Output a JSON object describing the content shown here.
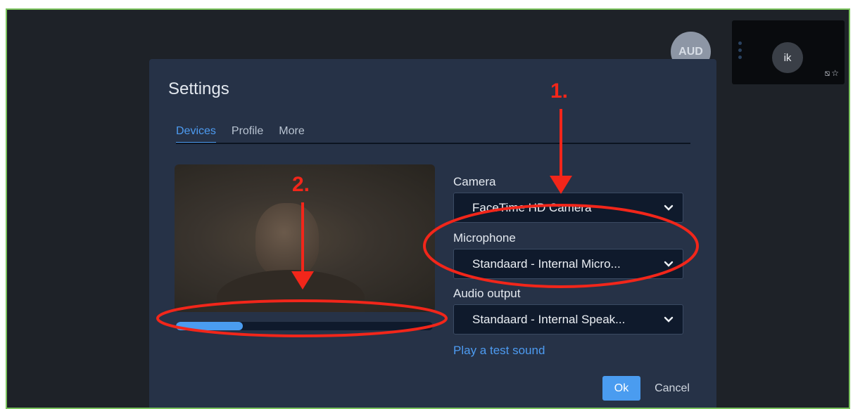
{
  "participants": {
    "aud_avatar": "AUD",
    "thumb_avatar": "ik",
    "thumb_icons": "⧅☆"
  },
  "settings": {
    "title": "Settings",
    "tabs": [
      {
        "label": "Devices",
        "active": true
      },
      {
        "label": "Profile",
        "active": false
      },
      {
        "label": "More",
        "active": false
      }
    ],
    "mic_level": 0.26,
    "camera_label": "Camera",
    "camera_value": "FaceTime HD Camera",
    "microphone_label": "Microphone",
    "microphone_value": "Standaard - Internal Micro...",
    "audio_output_label": "Audio output",
    "audio_output_value": "Standaard - Internal Speak...",
    "play_test_sound": "Play a test sound",
    "ok_label": "Ok",
    "cancel_label": "Cancel"
  },
  "annotations": {
    "marker_1": "1.",
    "marker_2": "2.",
    "color": "#f2261a"
  },
  "icons": {
    "dropdown": "chevron-down-icon",
    "video_off": "video-off-icon",
    "star": "star-icon"
  },
  "colors": {
    "accent": "#4d9bf1",
    "dialog_bg": "#263247",
    "page_bg": "#1e2228",
    "frame_border": "#7ac35d"
  }
}
